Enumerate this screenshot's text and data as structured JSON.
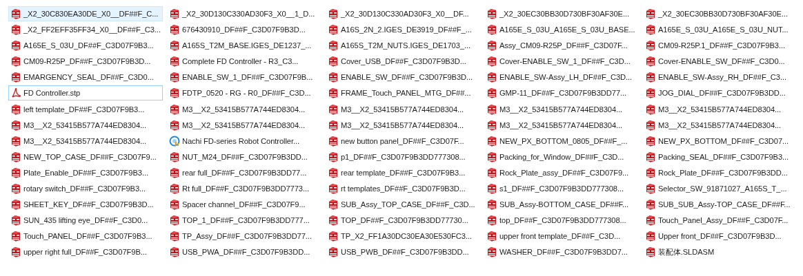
{
  "items": [
    {
      "name": "_X2_30C830EA30DE_X0__DF##F_C...",
      "kind": "assembly",
      "selected": true,
      "focused": false
    },
    {
      "name": "_X2_30D130C330AD30F3_X0__1_D...",
      "kind": "assembly",
      "selected": false,
      "focused": false
    },
    {
      "name": "_X2_30D130C330AD30F3_X0__DF...",
      "kind": "assembly",
      "selected": false,
      "focused": false
    },
    {
      "name": "_X2_30EC30BB30D730BF30AF30E...",
      "kind": "assembly",
      "selected": false,
      "focused": false
    },
    {
      "name": "_X2_30EC30BB30D730BF30AF30E...",
      "kind": "assembly",
      "selected": false,
      "focused": false
    },
    {
      "name": "_X2_FF2EFF35FF34_X0__DF##F_C3...",
      "kind": "assembly",
      "selected": false,
      "focused": false
    },
    {
      "name": "676430910_DF##F_C3D07F9B3D...",
      "kind": "assembly",
      "selected": false,
      "focused": false
    },
    {
      "name": "A16S_2N_2.IGES_DE3919_DF##F_...",
      "kind": "assembly",
      "selected": false,
      "focused": false
    },
    {
      "name": "A165E_S_03U_A165E_S_03U_BASE...",
      "kind": "assembly",
      "selected": false,
      "focused": false
    },
    {
      "name": "A165E_S_03U_A165E_S_03U_NUT...",
      "kind": "assembly",
      "selected": false,
      "focused": false
    },
    {
      "name": "A165E_S_03U_DF##F_C3D07F9B3...",
      "kind": "assembly",
      "selected": false,
      "focused": false
    },
    {
      "name": "A165S_T2M_BASE.IGES_DE1237_...",
      "kind": "assembly",
      "selected": false,
      "focused": false
    },
    {
      "name": "A165S_T2M_NUTS.IGES_DE1703_...",
      "kind": "assembly",
      "selected": false,
      "focused": false
    },
    {
      "name": "Assy_CM09-R25P_DF##F_C3D07F...",
      "kind": "assembly",
      "selected": false,
      "focused": false
    },
    {
      "name": "CM09-R25P.1_DF##F_C3D07F9B3...",
      "kind": "assembly",
      "selected": false,
      "focused": false
    },
    {
      "name": "CM09-R25P_DF##F_C3D07F9B3D...",
      "kind": "assembly",
      "selected": false,
      "focused": false
    },
    {
      "name": "Complete FD Controller - R3_C3...",
      "kind": "assembly",
      "selected": false,
      "focused": false
    },
    {
      "name": "Cover_USB_DF##F_C3D07F9B3D...",
      "kind": "assembly",
      "selected": false,
      "focused": false
    },
    {
      "name": "Cover-ENABLE_SW_1_DF##F_C3D...",
      "kind": "assembly",
      "selected": false,
      "focused": false
    },
    {
      "name": "Cover-ENABLE_SW_DF##F_C3D0...",
      "kind": "assembly",
      "selected": false,
      "focused": false
    },
    {
      "name": "EMARGENCY_SEAL_DF##F_C3D0...",
      "kind": "assembly",
      "selected": false,
      "focused": false
    },
    {
      "name": "ENABLE_SW_1_DF##F_C3D07F9B...",
      "kind": "assembly",
      "selected": false,
      "focused": false
    },
    {
      "name": "ENABLE_SW_DF##F_C3D07F9B3D...",
      "kind": "assembly",
      "selected": false,
      "focused": false
    },
    {
      "name": "ENABLE_SW-Assy_LH_DF##F_C3D...",
      "kind": "assembly",
      "selected": false,
      "focused": false
    },
    {
      "name": "ENABLE_SW-Assy_RH_DF##F_C3...",
      "kind": "assembly",
      "selected": false,
      "focused": false
    },
    {
      "name": "FD Controller.stp",
      "kind": "step",
      "selected": false,
      "focused": true
    },
    {
      "name": "FDTP_0520 - RG - R0_DF##F_C3D...",
      "kind": "assembly",
      "selected": false,
      "focused": false
    },
    {
      "name": "FRAME_Touch_PANEL_MTG_DF##...",
      "kind": "assembly",
      "selected": false,
      "focused": false
    },
    {
      "name": "GMP-11_DF##F_C3D07F9B3DD77...",
      "kind": "assembly",
      "selected": false,
      "focused": false
    },
    {
      "name": "JOG_DIAL_DF##F_C3D07F9B3DD...",
      "kind": "assembly",
      "selected": false,
      "focused": false
    },
    {
      "name": "left template_DF##F_C3D07F9B3...",
      "kind": "assembly",
      "selected": false,
      "focused": false
    },
    {
      "name": "M3__X2_53415B577A744ED8304...",
      "kind": "assembly",
      "selected": false,
      "focused": false
    },
    {
      "name": "M3__X2_53415B577A744ED8304...",
      "kind": "assembly",
      "selected": false,
      "focused": false
    },
    {
      "name": "M3__X2_53415B577A744ED8304...",
      "kind": "assembly",
      "selected": false,
      "focused": false
    },
    {
      "name": "M3__X2_53415B577A744ED8304...",
      "kind": "assembly",
      "selected": false,
      "focused": false
    },
    {
      "name": "M3__X2_53415B577A744ED8304...",
      "kind": "assembly",
      "selected": false,
      "focused": false
    },
    {
      "name": "M3__X2_53415B577A744ED8304...",
      "kind": "assembly",
      "selected": false,
      "focused": false
    },
    {
      "name": "M3__X2_53415B577A744ED8304...",
      "kind": "assembly",
      "selected": false,
      "focused": false
    },
    {
      "name": "M3__X2_53415B577A744ED8304...",
      "kind": "assembly",
      "selected": false,
      "focused": false
    },
    {
      "name": "M3__X2_53415B577A744ED8304...",
      "kind": "assembly",
      "selected": false,
      "focused": false
    },
    {
      "name": "M3__X2_53415B577A744ED8304...",
      "kind": "assembly",
      "selected": false,
      "focused": false
    },
    {
      "name": "Nachi FD-series Robot Controller...",
      "kind": "app",
      "selected": false,
      "focused": false
    },
    {
      "name": "new button panel_DF##F_C3D07F...",
      "kind": "assembly",
      "selected": false,
      "focused": false
    },
    {
      "name": "NEW_PX_BOTTOM_0805_DF##F_...",
      "kind": "assembly",
      "selected": false,
      "focused": false
    },
    {
      "name": "NEW_PX_BOTTOM_DF##F_C3D07...",
      "kind": "assembly",
      "selected": false,
      "focused": false
    },
    {
      "name": "NEW_TOP_CASE_DF##F_C3D07F9...",
      "kind": "assembly",
      "selected": false,
      "focused": false
    },
    {
      "name": "NUT_M24_DF##F_C3D07F9B3DD...",
      "kind": "assembly",
      "selected": false,
      "focused": false
    },
    {
      "name": "p1_DF##F_C3D07F9B3DD777308...",
      "kind": "assembly",
      "selected": false,
      "focused": false
    },
    {
      "name": "Packing_for_Window_DF##F_C3D...",
      "kind": "assembly",
      "selected": false,
      "focused": false
    },
    {
      "name": "Packing_SEAL_DF##F_C3D07F9B3...",
      "kind": "assembly",
      "selected": false,
      "focused": false
    },
    {
      "name": "Plate_Enable_DF##F_C3D07F9B3...",
      "kind": "assembly",
      "selected": false,
      "focused": false
    },
    {
      "name": "rear full_DF##F_C3D07F9B3DD77...",
      "kind": "assembly",
      "selected": false,
      "focused": false
    },
    {
      "name": "rear template_DF##F_C3D07F9B3...",
      "kind": "assembly",
      "selected": false,
      "focused": false
    },
    {
      "name": "Rock_Plate_assy_DF##F_C3D07F9...",
      "kind": "assembly",
      "selected": false,
      "focused": false
    },
    {
      "name": "Rock_Plate_DF##F_C3D07F9B3DD...",
      "kind": "assembly",
      "selected": false,
      "focused": false
    },
    {
      "name": "rotary switch_DF##F_C3D07F9B3...",
      "kind": "assembly",
      "selected": false,
      "focused": false
    },
    {
      "name": "Rt full_DF##F_C3D07F9B3DD7773...",
      "kind": "assembly",
      "selected": false,
      "focused": false
    },
    {
      "name": "rt templates_DF##F_C3D07F9B3D...",
      "kind": "assembly",
      "selected": false,
      "focused": false
    },
    {
      "name": "s1_DF##F_C3D07F9B3DD777308...",
      "kind": "assembly",
      "selected": false,
      "focused": false
    },
    {
      "name": "Selector_SW_91871027_A165S_T_...",
      "kind": "assembly",
      "selected": false,
      "focused": false
    },
    {
      "name": "SHEET_KEY_DF##F_C3D07F9B3D...",
      "kind": "assembly",
      "selected": false,
      "focused": false
    },
    {
      "name": "Spacer channel_DF##F_C3D07F9...",
      "kind": "assembly",
      "selected": false,
      "focused": false
    },
    {
      "name": "SUB_Assy_TOP_CASE_DF##F_C3D...",
      "kind": "assembly",
      "selected": false,
      "focused": false
    },
    {
      "name": "SUB_Assy-BOTTOM_CASE_DF##F...",
      "kind": "assembly",
      "selected": false,
      "focused": false
    },
    {
      "name": "SUB_SUB_Assy-TOP_CASE_DF##F...",
      "kind": "assembly",
      "selected": false,
      "focused": false
    },
    {
      "name": "SUN_435 lifting eye_DF##F_C3D0...",
      "kind": "assembly",
      "selected": false,
      "focused": false
    },
    {
      "name": "TOP_1_DF##F_C3D07F9B3DD777...",
      "kind": "assembly",
      "selected": false,
      "focused": false
    },
    {
      "name": "TOP_DF##F_C3D07F9B3DD77730...",
      "kind": "assembly",
      "selected": false,
      "focused": false
    },
    {
      "name": "top_DF##F_C3D07F9B3DD777308...",
      "kind": "assembly",
      "selected": false,
      "focused": false
    },
    {
      "name": "Touch_Panel_Assy_DF##F_C3D07F...",
      "kind": "assembly",
      "selected": false,
      "focused": false
    },
    {
      "name": "Touch_PANEL_DF##F_C3D07F9B3...",
      "kind": "assembly",
      "selected": false,
      "focused": false
    },
    {
      "name": "TP_Assy_DF##F_C3D07F9B3DD77...",
      "kind": "assembly",
      "selected": false,
      "focused": false
    },
    {
      "name": "TP_X2_FF1A30DC30EA30E530FC3...",
      "kind": "assembly",
      "selected": false,
      "focused": false
    },
    {
      "name": "upper front template_DF##F_C3D...",
      "kind": "assembly",
      "selected": false,
      "focused": false
    },
    {
      "name": "Upper front_DF##F_C3D07F9B3D...",
      "kind": "assembly",
      "selected": false,
      "focused": false
    },
    {
      "name": "upper right full_DF##F_C3D07F9B...",
      "kind": "assembly",
      "selected": false,
      "focused": false
    },
    {
      "name": "USB_PWA_DF##F_C3D07F9B3DD...",
      "kind": "assembly",
      "selected": false,
      "focused": false
    },
    {
      "name": "USB_PWB_DF##F_C3D07F9B3DD...",
      "kind": "assembly",
      "selected": false,
      "focused": false
    },
    {
      "name": "WASHER_DF##F_C3D07F9B3DD7...",
      "kind": "assembly",
      "selected": false,
      "focused": false
    },
    {
      "name": "装配体.SLDASM",
      "kind": "assembly",
      "selected": false,
      "focused": false
    }
  ]
}
